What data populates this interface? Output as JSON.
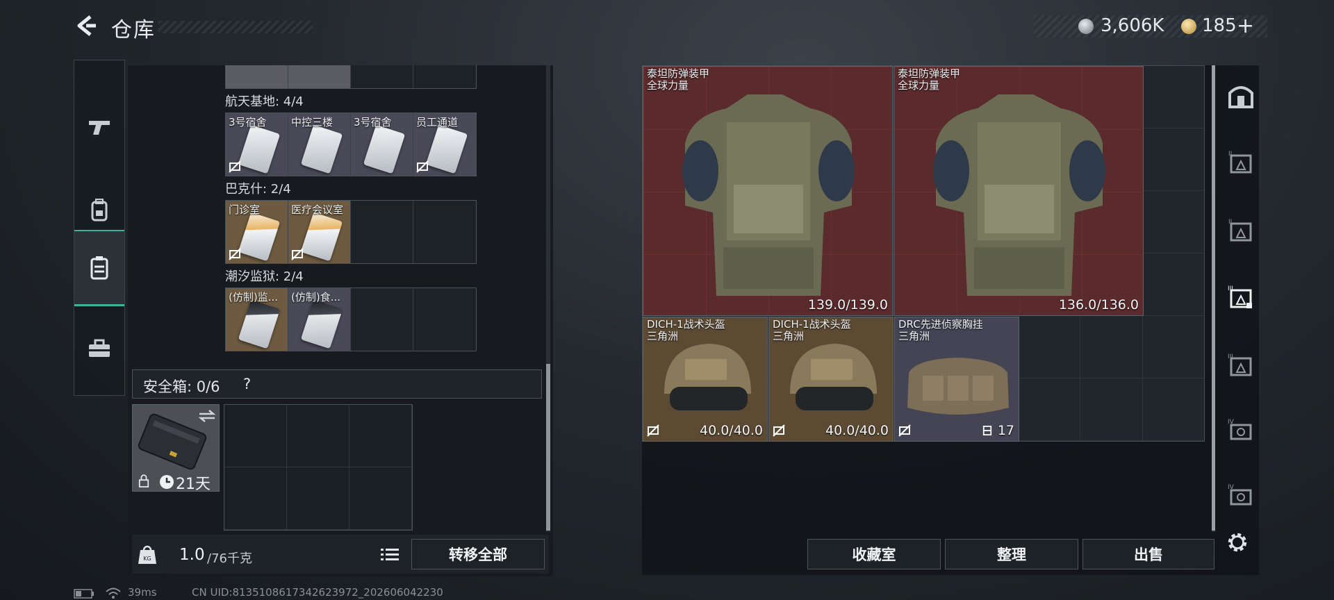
{
  "header": {
    "title": "仓库"
  },
  "currency": {
    "silver": "3,606K",
    "gold": "185",
    "add": "+"
  },
  "tabs": [
    {
      "name": "weapons",
      "icon": "pistol-icon"
    },
    {
      "name": "equipment",
      "icon": "backpack-icon"
    },
    {
      "name": "containers",
      "icon": "container-icon",
      "active": true
    },
    {
      "name": "toolbox",
      "icon": "toolbox-icon"
    }
  ],
  "left": {
    "groups": [
      {
        "title": "航天基地: 4/4",
        "items": [
          "3号宿舍",
          "中控三楼",
          "3号宿舍",
          "员工通道"
        ]
      },
      {
        "title": "巴克什: 2/4",
        "items": [
          "门诊室",
          "医疗会议室"
        ]
      },
      {
        "title": "潮汐监狱: 2/4",
        "items": [
          "(仿制)监...",
          "(仿制)食..."
        ]
      }
    ],
    "safe_box": {
      "label": "安全箱: 0/6",
      "help": "?",
      "timer": "21天"
    },
    "weight": {
      "current": "1.0",
      "max": "/76千克"
    },
    "transfer_all": "转移全部"
  },
  "stash": {
    "items": [
      {
        "name": "泰坦防弹装甲",
        "brand": "全球力量",
        "durability": "139.0/139.0"
      },
      {
        "name": "泰坦防弹装甲",
        "brand": "全球力量",
        "durability": "136.0/136.0"
      },
      {
        "name": "DICH-1战术头盔",
        "brand": "三角洲",
        "durability": "40.0/40.0"
      },
      {
        "name": "DICH-1战术头盔",
        "brand": "三角洲",
        "durability": "40.0/40.0"
      },
      {
        "name": "DRC先进侦察胸挂",
        "brand": "三角洲",
        "count": "17"
      }
    ]
  },
  "actions": {
    "collection": "收藏室",
    "sort": "整理",
    "sell": "出售"
  },
  "status": {
    "ping": "39ms",
    "uid": "CN UID:813510861734262397​2_202606042230"
  },
  "colors": {
    "accent": "#3fb39a",
    "armor_bg": "#5b2a2c",
    "gold_bg": "#5c4a33"
  }
}
